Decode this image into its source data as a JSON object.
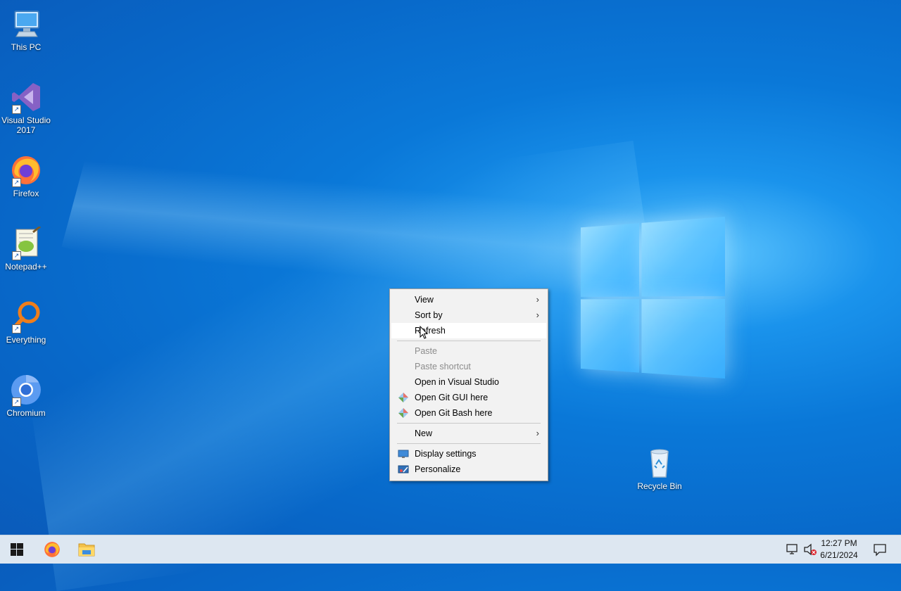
{
  "desktop_icons": [
    {
      "label": "This PC",
      "icon": "computer-icon"
    },
    {
      "label": "Visual Studio 2017",
      "icon": "visual-studio-icon"
    },
    {
      "label": "Firefox",
      "icon": "firefox-icon"
    },
    {
      "label": "Notepad++",
      "icon": "notepad-plus-plus-icon"
    },
    {
      "label": "Everything",
      "icon": "everything-search-icon"
    },
    {
      "label": "Chromium",
      "icon": "chromium-icon"
    },
    {
      "label": "Recycle Bin",
      "icon": "recycle-bin-icon"
    }
  ],
  "context_menu": {
    "items": [
      {
        "label": "View",
        "submenu": true
      },
      {
        "label": "Sort by",
        "submenu": true
      },
      {
        "label": "Refresh",
        "highlighted": true
      },
      {
        "label": "Paste",
        "disabled": true
      },
      {
        "label": "Paste shortcut",
        "disabled": true
      },
      {
        "label": "Open in Visual Studio"
      },
      {
        "label": "Open Git GUI here",
        "icon": "git-icon"
      },
      {
        "label": "Open Git Bash here",
        "icon": "git-icon"
      },
      {
        "label": "New",
        "submenu": true
      },
      {
        "label": "Display settings",
        "icon": "display-icon"
      },
      {
        "label": "Personalize",
        "icon": "personalize-icon"
      }
    ]
  },
  "taskbar": {
    "time": "12:27 PM",
    "date": "6/21/2024",
    "pinned": [
      "start-icon",
      "firefox-icon",
      "file-explorer-icon"
    ]
  },
  "colors": {
    "desktop_blue": "#0a78d8",
    "taskbar_bg": "#dde7f1",
    "menu_bg": "#f2f2f2"
  }
}
